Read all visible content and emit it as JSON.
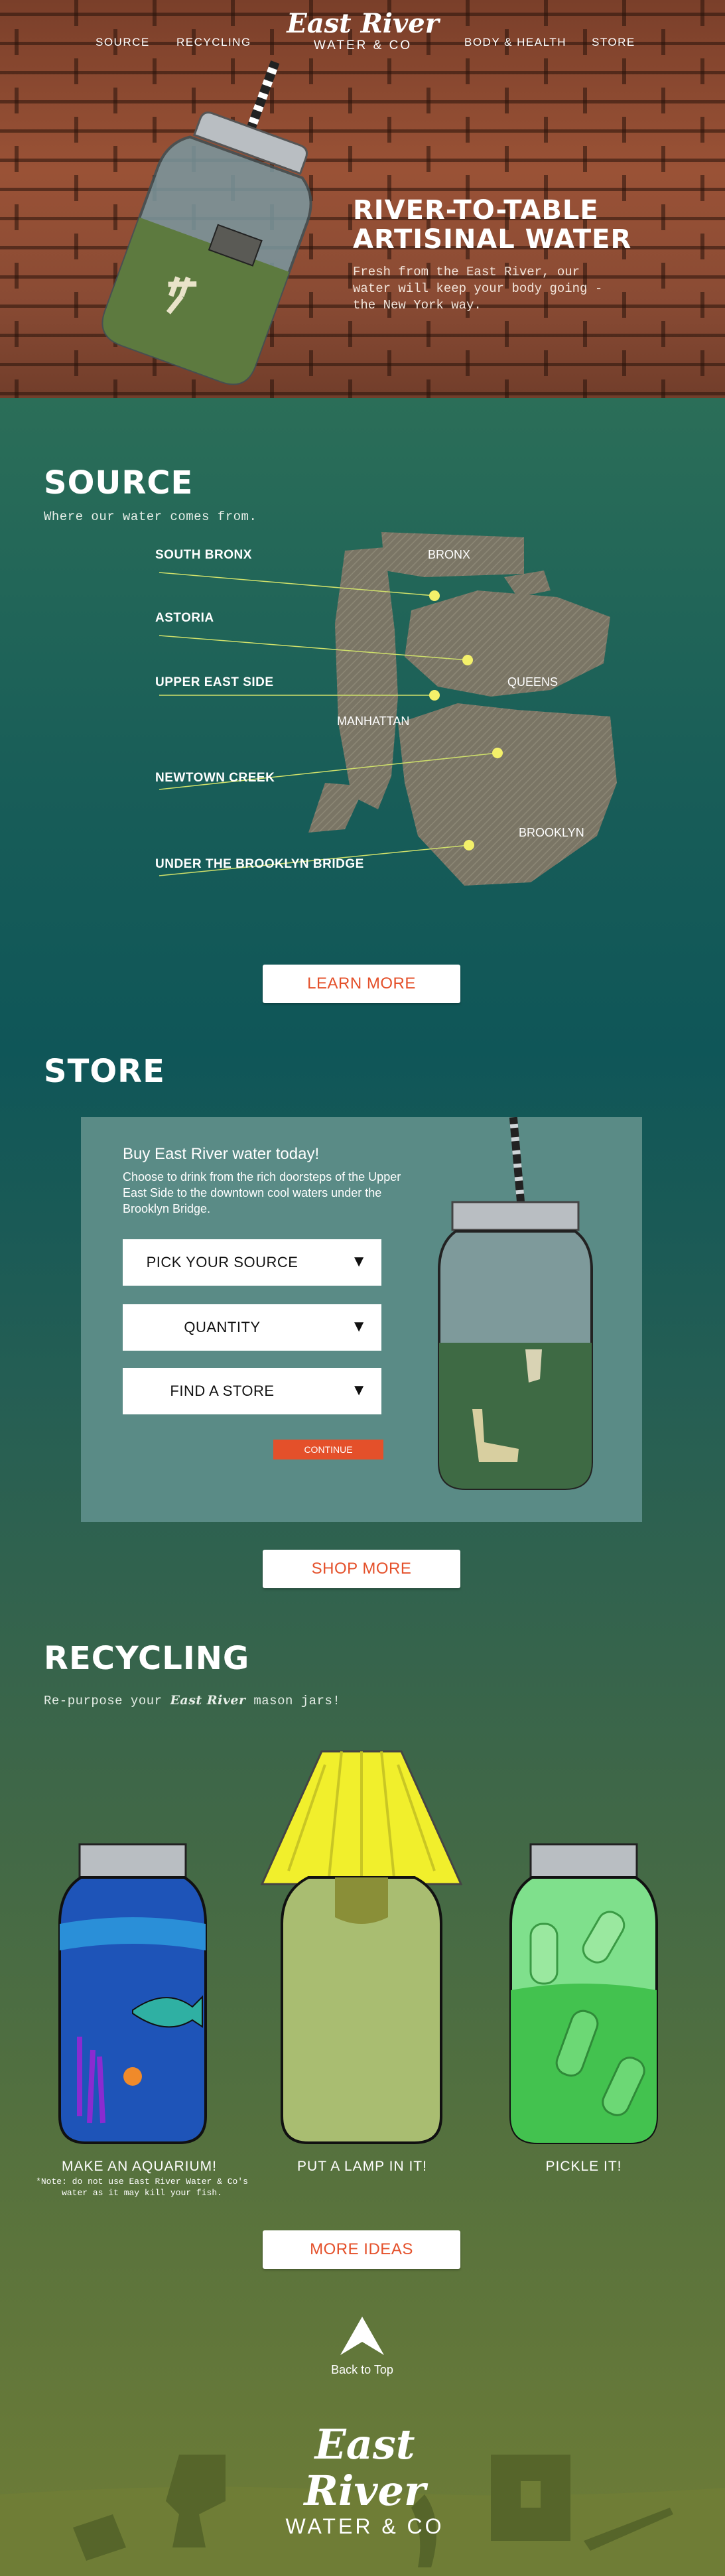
{
  "nav": {
    "source": "SOURCE",
    "recycling": "RECYCLING",
    "body_health": "BODY & HEALTH",
    "store": "STORE"
  },
  "brand": {
    "script": "East River",
    "sub": "WATER & CO"
  },
  "hero": {
    "title_line1": "RIVER-TO-TABLE",
    "title_line2": "ARTISINAL WATER",
    "text": "Fresh from the East River, our water will keep your body going - the New York way."
  },
  "source": {
    "heading": "SOURCE",
    "subheading": "Where our water comes from.",
    "locations": [
      "SOUTH BRONX",
      "ASTORIA",
      "UPPER EAST SIDE",
      "NEWTOWN CREEK",
      "UNDER THE BROOKLYN BRIDGE"
    ],
    "boroughs": [
      "BRONX",
      "QUEENS",
      "MANHATTAN",
      "BROOKLYN"
    ],
    "button": "LEARN MORE"
  },
  "store": {
    "heading": "STORE",
    "panel_title": "Buy East River water today!",
    "panel_text": "Choose to drink from the rich doorsteps of the Upper East Side to the downtown cool waters under the Brooklyn Bridge.",
    "select_source": "PICK YOUR SOURCE",
    "select_quantity": "QUANTITY",
    "select_store": "FIND A STORE",
    "arrow": "▼",
    "continue": "CONTINUE",
    "button": "SHOP MORE"
  },
  "recycling": {
    "heading": "RECYCLING",
    "sub_pre": "Re-purpose your ",
    "sub_brand": "East River",
    "sub_post": " mason jars!",
    "captions": [
      "MAKE AN AQUARIUM!",
      "PUT A LAMP IN IT!",
      "PICKLE IT!"
    ],
    "note": "*Note: do not use East River Water & Co's water as it may kill your fish.",
    "button": "MORE IDEAS"
  },
  "footer": {
    "back_to_top": "Back to Top"
  },
  "colors": {
    "accent": "#e4502a",
    "map_fill": "#7a7565",
    "dot": "#f3f06a",
    "panel": "#5a8b86"
  }
}
